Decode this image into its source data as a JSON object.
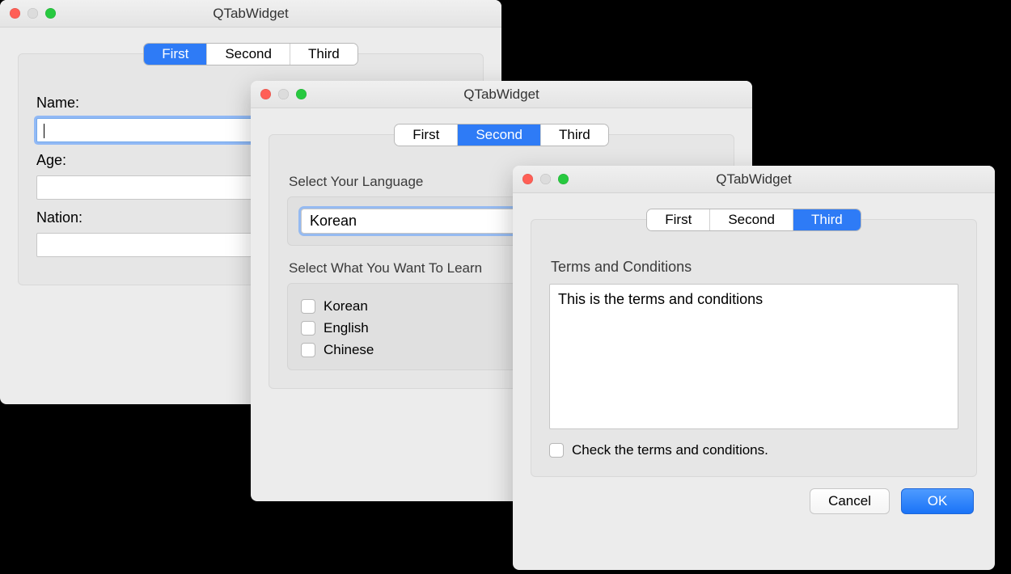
{
  "window1": {
    "title": "QTabWidget",
    "tabs": [
      "First",
      "Second",
      "Third"
    ],
    "active_tab": 0,
    "fields": {
      "name_label": "Name:",
      "name_value": "",
      "age_label": "Age:",
      "age_value": "",
      "nation_label": "Nation:",
      "nation_value": ""
    }
  },
  "window2": {
    "title": "QTabWidget",
    "tabs": [
      "First",
      "Second",
      "Third"
    ],
    "active_tab": 1,
    "language_group_label": "Select Your Language",
    "language_selected": "Korean",
    "learn_group_label": "Select What You Want To Learn",
    "learn_options": [
      "Korean",
      "English",
      "Chinese"
    ]
  },
  "window3": {
    "title": "QTabWidget",
    "tabs": [
      "First",
      "Second",
      "Third"
    ],
    "active_tab": 2,
    "terms_label": "Terms and Conditions",
    "terms_text": "This is the terms and conditions",
    "check_label": "Check the terms and conditions.",
    "check_checked": false,
    "buttons": {
      "cancel": "Cancel",
      "ok": "OK"
    }
  }
}
